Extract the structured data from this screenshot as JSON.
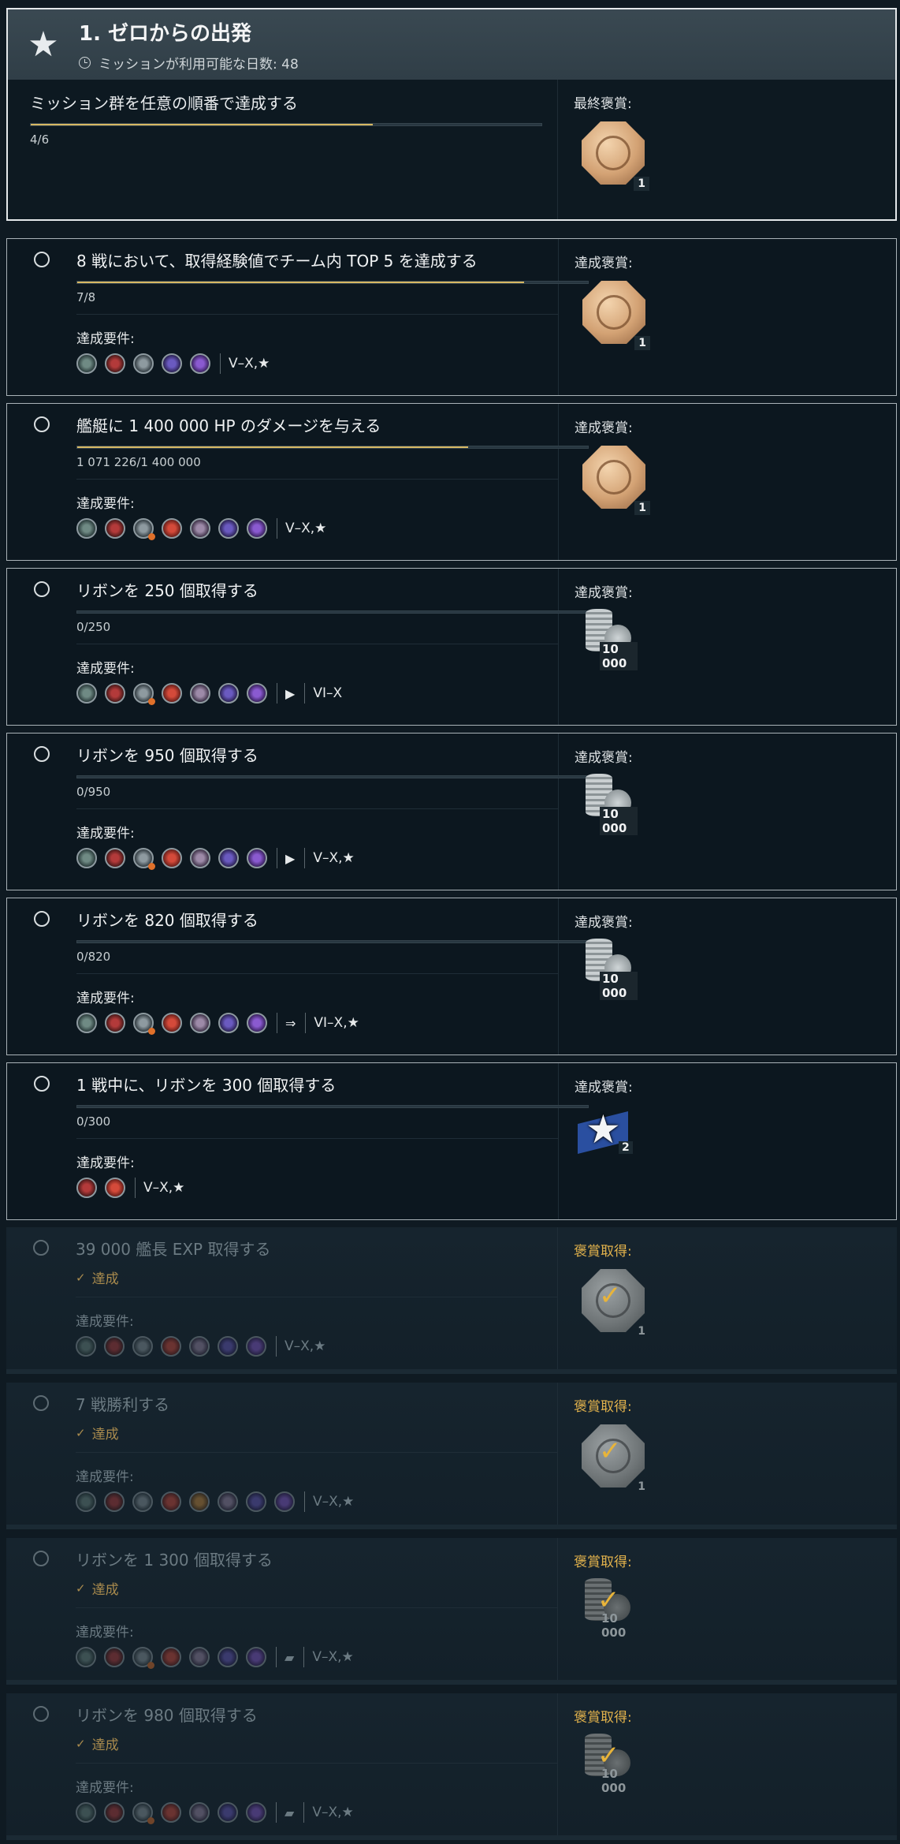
{
  "header": {
    "title": "1. ゼロからの出発",
    "days": "ミッションが利用可能な日数: 48",
    "goal": "ミッション群を任意の順番で達成する",
    "progress_text": "4/6",
    "progress_fraction": 0.67,
    "reward_label": "最終褒賞:",
    "reward_qty": "1"
  },
  "labels": {
    "requirements": "達成要件:",
    "reward": "達成褒賞:",
    "reward_obtained": "褒賞取得:",
    "done": "達成"
  },
  "missions": [
    {
      "title": "8 戦において、取得経験値でチーム内 TOP 5 を達成する",
      "progress_text": "7/8",
      "progress_fraction": 0.875,
      "tier": "V–X,★",
      "reward_qty": "1"
    },
    {
      "title": "艦艇に 1 400 000 HP のダメージを与える",
      "progress_text": "1 071 226/1 400 000",
      "progress_fraction": 0.765,
      "tier": "V–X,★",
      "reward_qty": "1"
    },
    {
      "title": "リボンを 250 個取得する",
      "progress_text": "0/250",
      "progress_fraction": 0,
      "tier": "VI–X",
      "reward_qty": "10 000"
    },
    {
      "title": "リボンを 950 個取得する",
      "progress_text": "0/950",
      "progress_fraction": 0,
      "tier": "V–X,★",
      "reward_qty": "10 000"
    },
    {
      "title": "リボンを 820 個取得する",
      "progress_text": "0/820",
      "progress_fraction": 0,
      "tier": "VI–X,★",
      "reward_qty": "10 000"
    },
    {
      "title": "1 戦中に、リボンを 300 個取得する",
      "progress_text": "0/300",
      "progress_fraction": 0,
      "tier": "V–X,★",
      "reward_qty": "2"
    },
    {
      "title": "39 000 艦長 EXP 取得する",
      "tier": "V–X,★",
      "reward_qty": "1"
    },
    {
      "title": "7 戦勝利する",
      "tier": "V–X,★",
      "reward_qty": "1"
    },
    {
      "title": "リボンを 1 300 個取得する",
      "tier": "V–X,★",
      "reward_qty": "10 000"
    },
    {
      "title": "リボンを 980 個取得する",
      "tier": "V–X,★",
      "reward_qty": "10 000"
    }
  ]
}
